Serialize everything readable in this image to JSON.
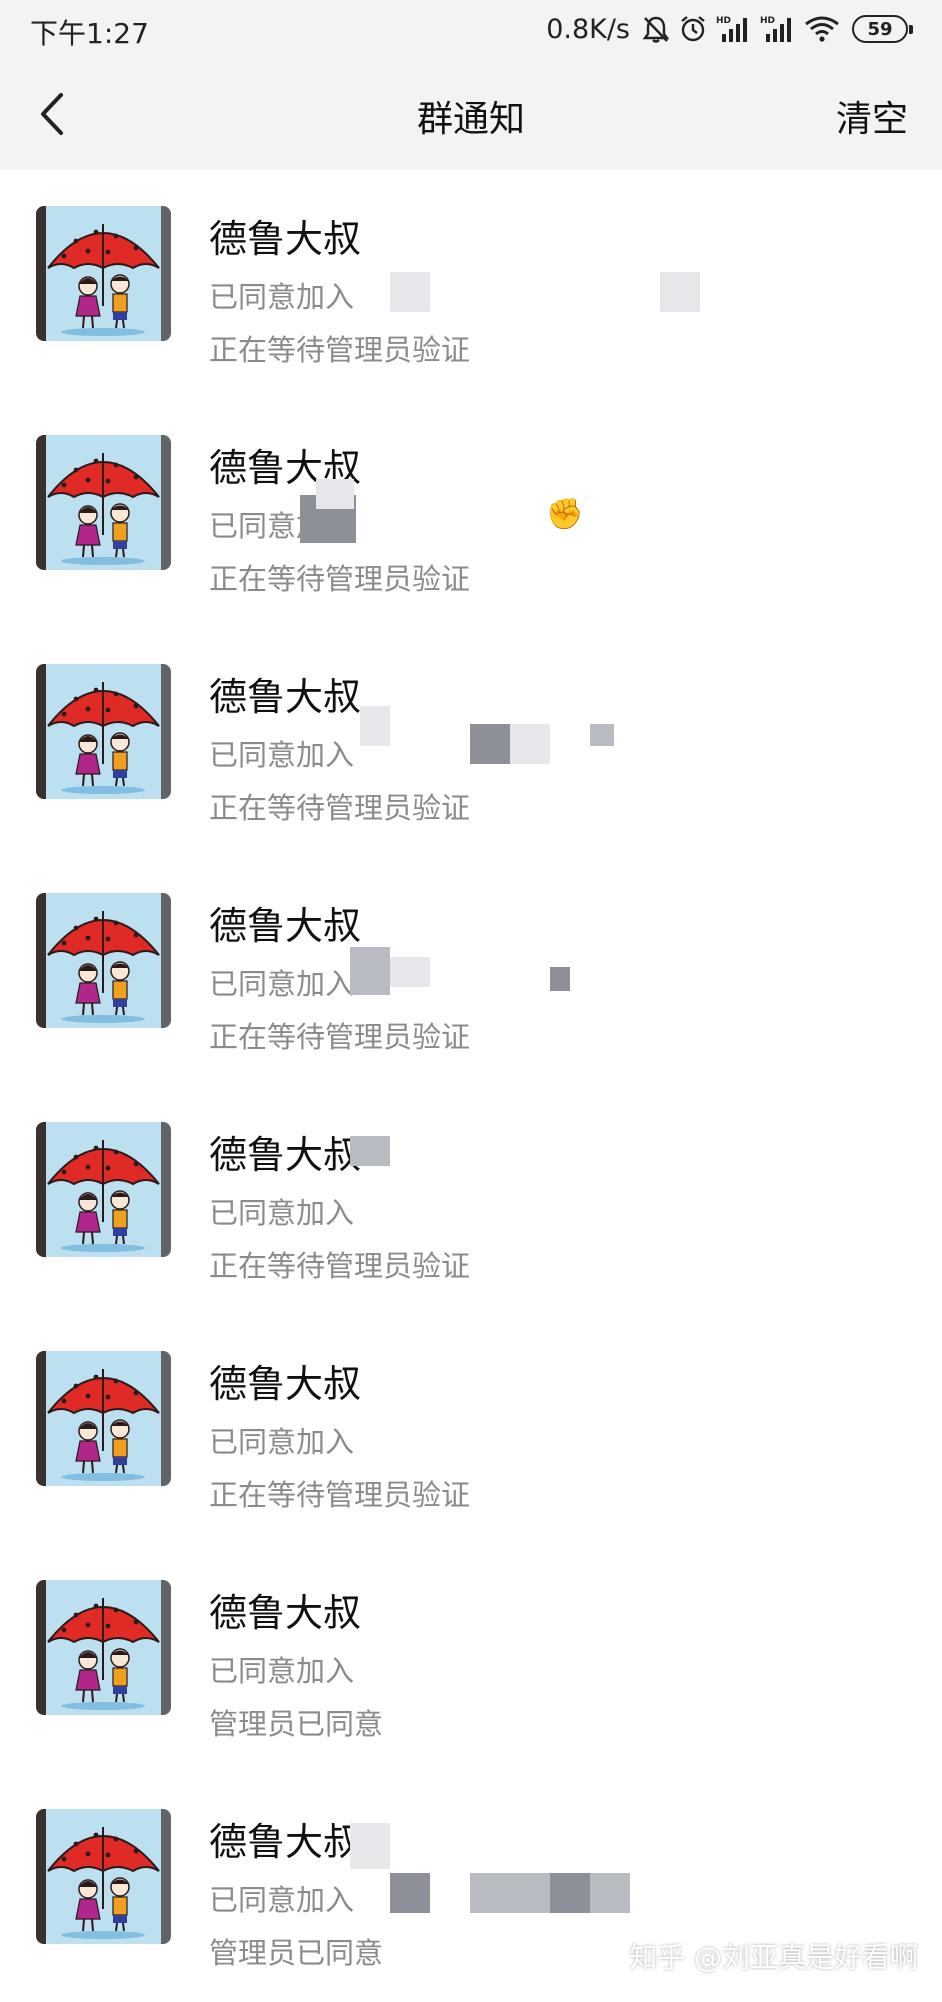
{
  "status_bar": {
    "time": "下午1:27",
    "network_speed": "0.8K/s",
    "battery_level": "59",
    "icons": [
      "mute-bell-icon",
      "alarm-icon",
      "hd-signal-icon",
      "hd-signal-icon",
      "wifi-icon",
      "battery-icon"
    ]
  },
  "header": {
    "title": "群通知",
    "clear_label": "清空",
    "back_icon": "chevron-left-icon"
  },
  "notifications": [
    {
      "name": "德鲁大叔",
      "action": "已同意加入",
      "status": "正在等待管理员验证"
    },
    {
      "name": "德鲁大叔",
      "action": "已同意加入",
      "status": "正在等待管理员验证"
    },
    {
      "name": "德鲁大叔",
      "action": "已同意加入",
      "status": "正在等待管理员验证"
    },
    {
      "name": "德鲁大叔",
      "action": "已同意加入",
      "status": "正在等待管理员验证"
    },
    {
      "name": "德鲁大叔",
      "action": "已同意加入",
      "status": "正在等待管理员验证"
    },
    {
      "name": "德鲁大叔",
      "action": "已同意加入",
      "status": "正在等待管理员验证"
    },
    {
      "name": "德鲁大叔",
      "action": "已同意加入",
      "status": "管理员已同意"
    },
    {
      "name": "德鲁大叔",
      "action": "已同意加入",
      "status": "管理员已同意"
    }
  ],
  "watermark": "知乎 @刘亚真是好看啊",
  "colors": {
    "header_bg": "#f2f3f5",
    "secondary_text": "#8a8a8f",
    "primary_text": "#111111"
  }
}
